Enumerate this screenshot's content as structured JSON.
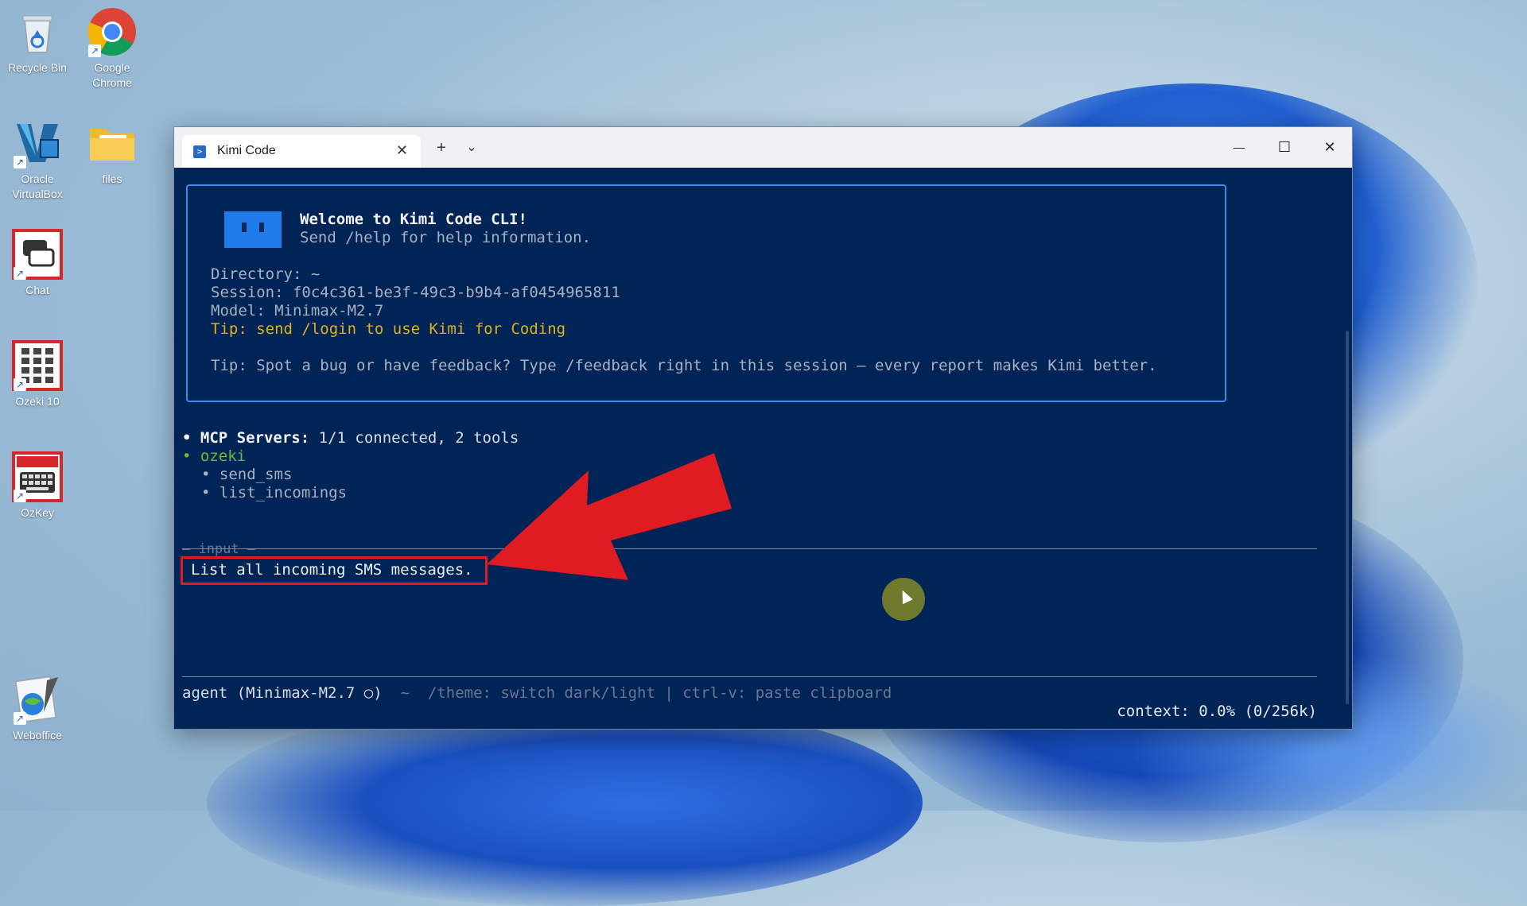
{
  "desktop": {
    "icons": [
      {
        "label": "Recycle Bin"
      },
      {
        "label": "Google Chrome"
      },
      {
        "label": "Oracle VirtualBox"
      },
      {
        "label": "files"
      },
      {
        "label": "Chat"
      },
      {
        "label": "Ozeki 10"
      },
      {
        "label": "OzKey"
      },
      {
        "label": "Weboffice"
      }
    ]
  },
  "window": {
    "tab_title": "Kimi Code",
    "tab_close": "✕",
    "new_tab": "+",
    "dropdown": "⌄",
    "minimize": "—",
    "maximize": "☐",
    "close": "✕"
  },
  "terminal": {
    "welcome_title": "Welcome to Kimi Code CLI!",
    "welcome_help": "Send /help for help information.",
    "directory": "Directory: ~",
    "session": "Session: f0c4c361-be3f-49c3-b9b4-af0454965811",
    "model": "Model: Minimax-M2.7",
    "tip_login": "Tip: send /login to use Kimi for Coding",
    "tip_feedback": "Tip: Spot a bug or have feedback? Type /feedback right in this session — every report makes Kimi better.",
    "mcp_bullet": "•",
    "mcp_label": "MCP Servers:",
    "mcp_status": " 1/1 connected, 2 tools",
    "server_name": "• ozeki",
    "tools": [
      "• send_sms",
      "• list_incomings"
    ],
    "input_label": "— input —",
    "input_value": "List all incoming SMS messages.",
    "agent_prompt": "agent (Minimax-M2.7 ○)",
    "tilde": "~",
    "hint": "/theme: switch dark/light | ctrl-v: paste clipboard",
    "context": "context: 0.0% (0/256k)"
  },
  "colors": {
    "terminal_bg": "#012456",
    "accent_border": "#3d8bf0",
    "tip_yellow": "#e0b21a",
    "server_green": "#5fbf3a",
    "annotation_red": "#e11b22"
  }
}
